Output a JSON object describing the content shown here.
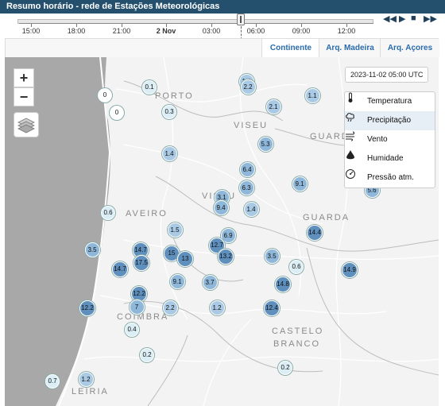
{
  "title": "Resumo horário - rede de Estações Meteorológicas",
  "timeline": {
    "labels": [
      "15:00",
      "18:00",
      "21:00",
      "2 Nov",
      "03:00",
      "06:00",
      "09:00",
      "12:00"
    ],
    "controls": {
      "prev": "◀◀",
      "play": "▶",
      "stop": "■",
      "next": "▶▶"
    }
  },
  "tabs": [
    "Continente",
    "Arq. Madeira",
    "Arq. Açores"
  ],
  "zoom": {
    "in": "+",
    "out": "−"
  },
  "timestamp": "2023-11-02 05:00 UTC",
  "layers": [
    {
      "label": "Temperatura",
      "icon": "thermometer-icon"
    },
    {
      "label": "Precipitação",
      "icon": "cloud-rain-icon"
    },
    {
      "label": "Vento",
      "icon": "wind-icon"
    },
    {
      "label": "Humidade",
      "icon": "humidity-icon"
    },
    {
      "label": "Pressão atm.",
      "icon": "gauge-icon"
    }
  ],
  "map_labels": [
    "PORTO",
    "VISEU",
    "GUARDA",
    "AVEIRO",
    "VISEU",
    "GUARDA",
    "COIMBRA",
    "CASTELO",
    "BRANCO",
    "LEIRIA"
  ],
  "stations": [
    "0.1",
    "0",
    "0",
    "0.3",
    "1.5",
    "2.2",
    "2.1",
    "1.1",
    "1.4",
    "5.3",
    "6.4",
    "6.3",
    "9.1",
    "5.6",
    "3.1",
    "9.4",
    "1.4",
    "0.6",
    "6.9",
    "14.4",
    "1.5",
    "3.5",
    "14.7",
    "14.7",
    "17.5",
    "15",
    "13",
    "12.7",
    "13.2",
    "3.5",
    "0.6",
    "14.9",
    "9.1",
    "3.7",
    "14.8",
    "12.2",
    "12.2",
    "7",
    "2.2",
    "1.2",
    "12.4",
    "0.4",
    "0.2",
    "0.2",
    "0.7",
    "1.2"
  ]
}
